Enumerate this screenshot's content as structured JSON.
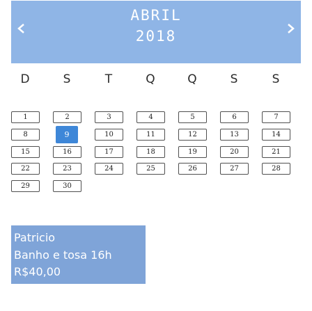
{
  "header": {
    "month": "ABRIL",
    "year": "2018",
    "color": "#8fb5e6",
    "prev_icon": "chevron-left-icon",
    "next_icon": "chevron-right-icon"
  },
  "weekdays": [
    "D",
    "S",
    "T",
    "Q",
    "Q",
    "S",
    "S"
  ],
  "days": [
    "1",
    "2",
    "3",
    "4",
    "5",
    "6",
    "7",
    "8",
    "9",
    "10",
    "11",
    "12",
    "13",
    "14",
    "15",
    "16",
    "17",
    "18",
    "19",
    "20",
    "21",
    "22",
    "23",
    "24",
    "25",
    "26",
    "27",
    "28",
    "29",
    "30"
  ],
  "selected_day": "9",
  "selected_color": "#3e87d8",
  "event": {
    "title": "Patricio",
    "description": "Banho e tosa 16h",
    "price": "R$40,00",
    "color": "#7fa4d8"
  }
}
